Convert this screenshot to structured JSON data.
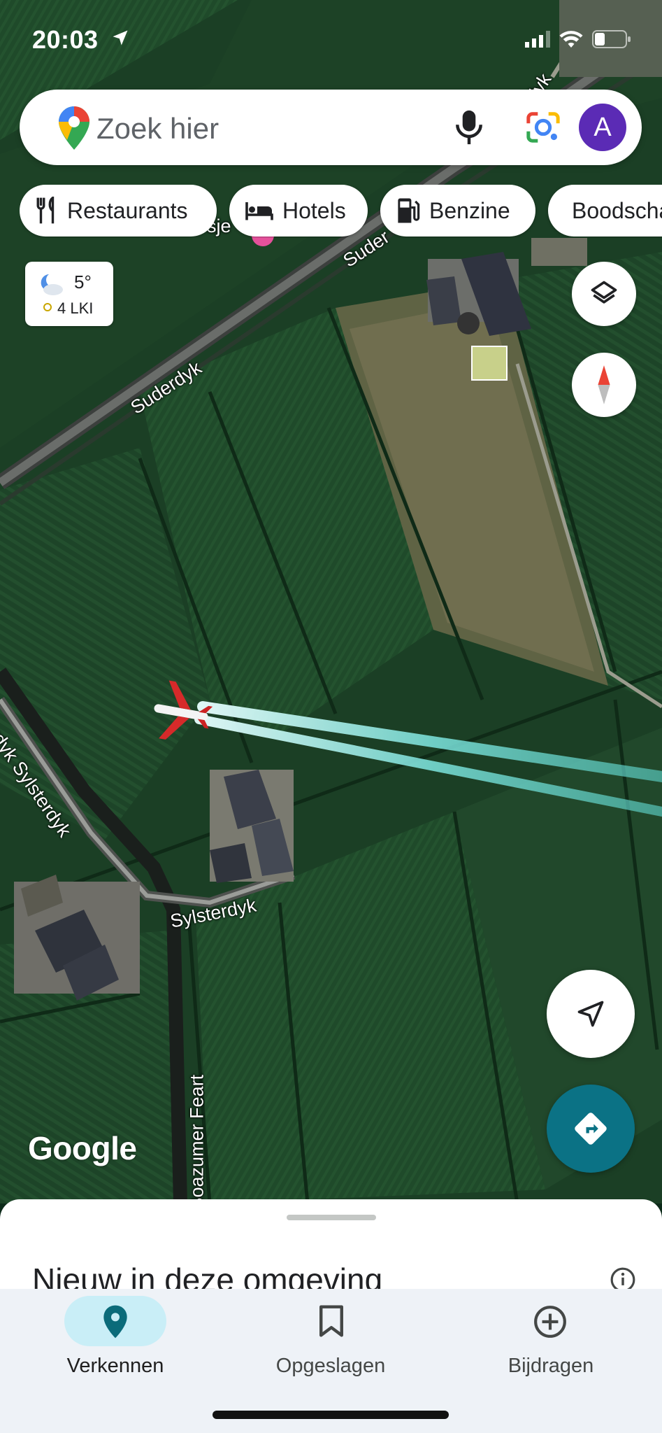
{
  "status_bar": {
    "time": "20:03"
  },
  "search": {
    "placeholder": "Zoek hier",
    "avatar_letter": "A"
  },
  "chips": [
    {
      "label": "Restaurants",
      "icon": "restaurant-icon"
    },
    {
      "label": "Hotels",
      "icon": "hotel-icon"
    },
    {
      "label": "Benzine",
      "icon": "gas-station-icon"
    },
    {
      "label": "Boodschappen",
      "icon": "cart-icon"
    }
  ],
  "weather": {
    "temperature": "5°",
    "air_quality": "4 LKI"
  },
  "map_labels": {
    "suderdyk_1": "Suderdyk",
    "suderdyk_2": "Suder",
    "sylsterdyk_1": "rdyk Sylsterdyk",
    "sylsterdyk_2": "Sylsterdyk",
    "boazumer": "Boazumer Feart",
    "partial_top": "dyk",
    "partial_pin": "sje"
  },
  "google_logo": "Google",
  "sheet": {
    "title": "Nieuw in deze omgeving"
  },
  "nav": {
    "explore": "Verkennen",
    "saved": "Opgeslagen",
    "contribute": "Bijdragen"
  },
  "colors": {
    "accent": "#0b7285",
    "avatar": "#5b2bb5",
    "nav_active_pill": "#c9eef7"
  }
}
